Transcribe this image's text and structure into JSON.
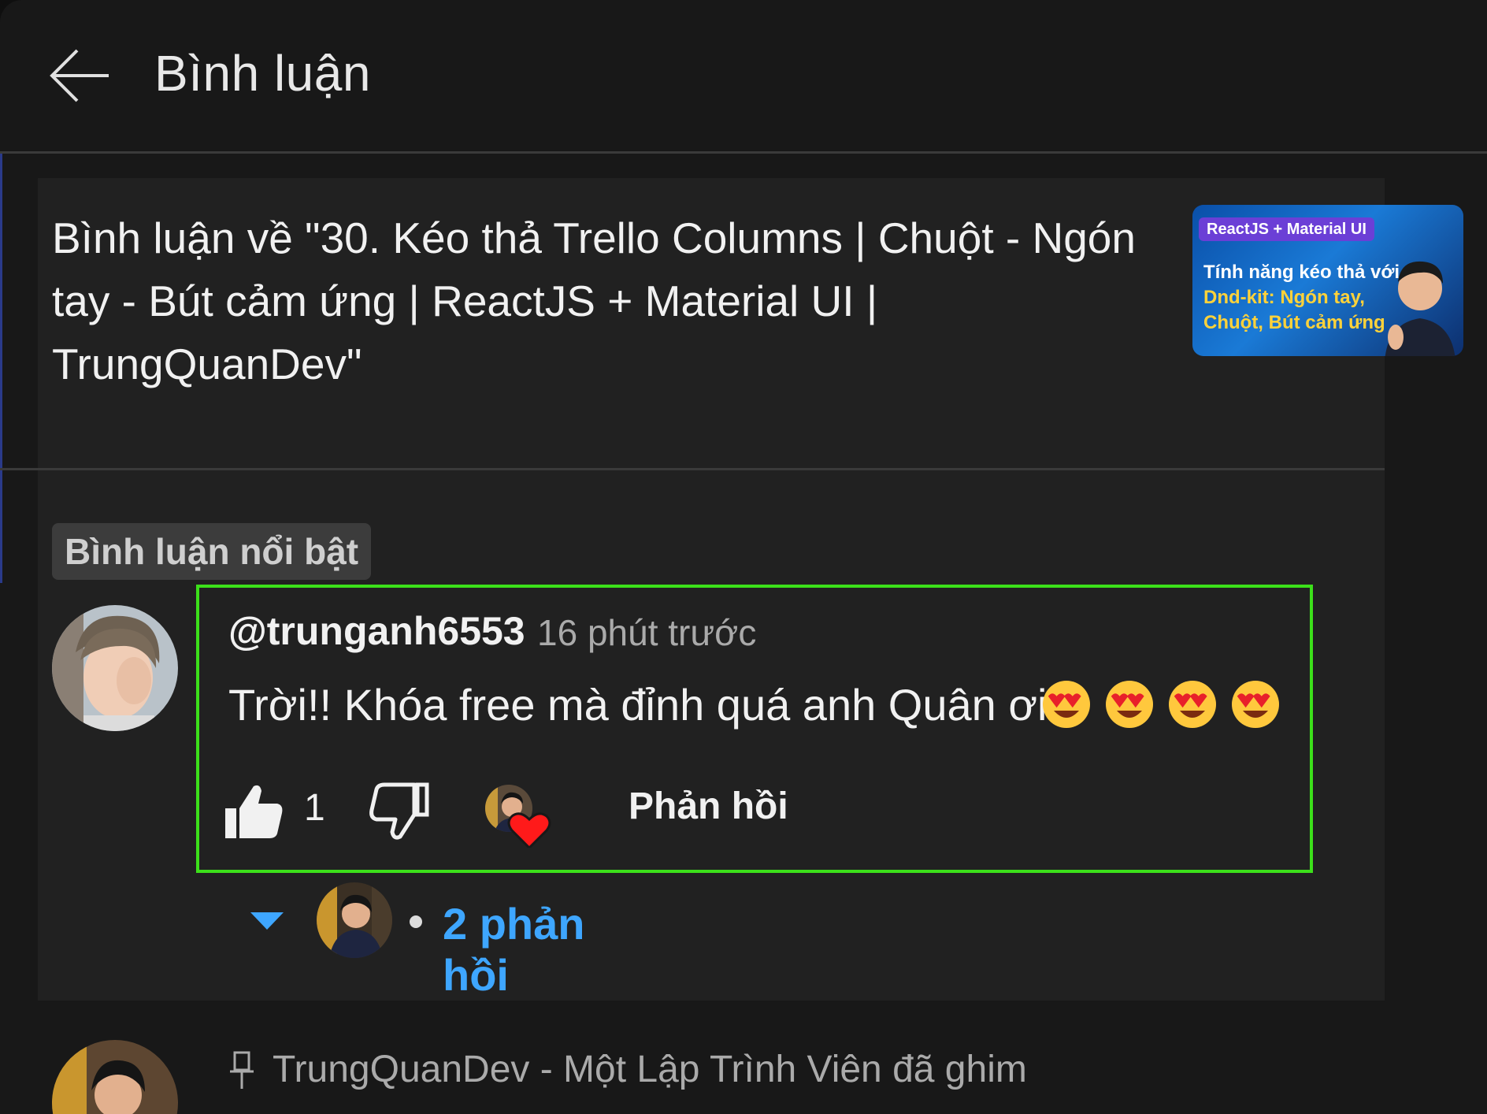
{
  "header": {
    "title": "Bình luận"
  },
  "video_context": {
    "title": "Bình luận về \"30. Kéo thả Trello Columns | Chuột - Ngón tay - Bút cảm ứng | ReactJS + Material UI | TrungQuanDev\"",
    "thumbnail": {
      "badge": "ReactJS + Material UI",
      "line1": "Tính năng kéo thả với",
      "line2": "Dnd-kit: Ngón tay,",
      "line3": "Chuột, Bút cảm ứng"
    }
  },
  "featured_label": "Bình luận nổi bật",
  "comment": {
    "author": "@trunganh6553",
    "time": "16 phút trước",
    "text": "Trời!! Khóa free mà đỉnh quá anh Quân ơi",
    "emoji_count": 4,
    "likes": "1",
    "reply_label": "Phản hồi",
    "replies_label": "2 phản hồi"
  },
  "pinned": {
    "text": "TrungQuanDev - Một Lập Trình Viên đã ghim"
  },
  "colors": {
    "background": "#181818",
    "card": "#212121",
    "highlight_border": "#3ce01a",
    "link_blue": "#3ea6ff",
    "heart_red": "#ff1a1a"
  },
  "icons": [
    "back-arrow-icon",
    "thumbs-up-icon",
    "thumbs-down-icon",
    "heart-icon",
    "caret-down-icon",
    "pin-icon",
    "heart-eyes-emoji-icon"
  ]
}
